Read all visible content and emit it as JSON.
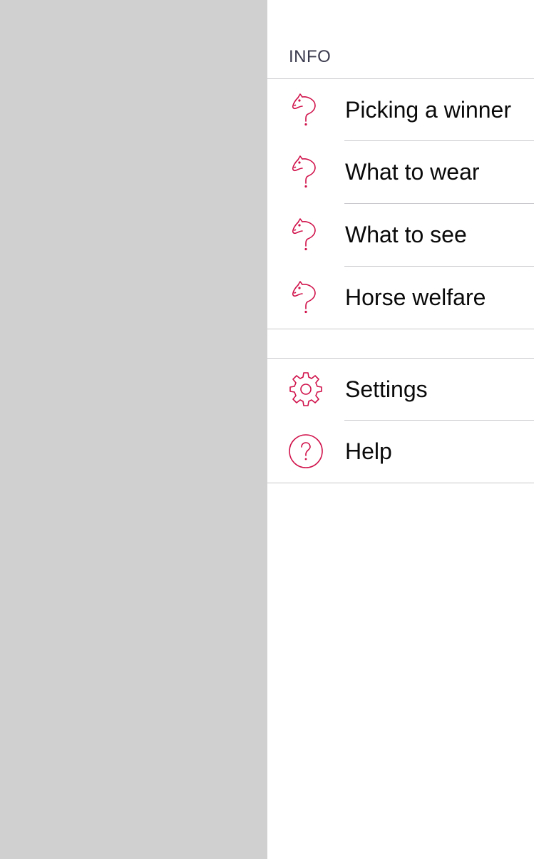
{
  "menu": {
    "section_header": "INFO",
    "accent_color": "#d0114a",
    "info_items": [
      {
        "label": "Picking a winner",
        "icon": "horse-question-icon"
      },
      {
        "label": "What to wear",
        "icon": "horse-question-icon"
      },
      {
        "label": "What to see",
        "icon": "horse-question-icon"
      },
      {
        "label": "Horse welfare",
        "icon": "horse-question-icon"
      }
    ],
    "other_items": [
      {
        "label": "Settings",
        "icon": "gear-icon"
      },
      {
        "label": "Help",
        "icon": "help-circle-icon"
      }
    ]
  }
}
